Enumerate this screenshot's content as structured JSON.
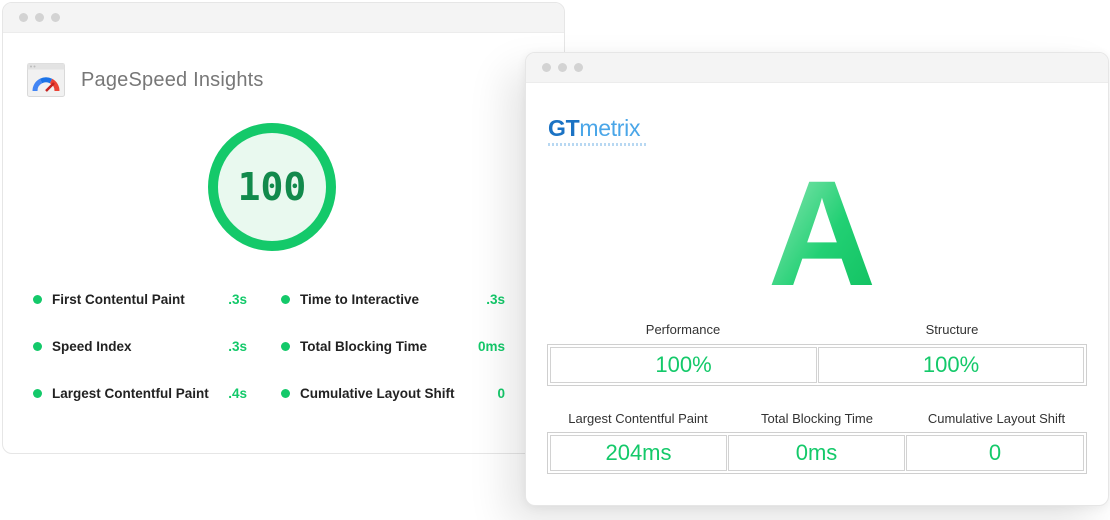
{
  "pagespeed": {
    "title": "PageSpeed Insights",
    "score": "100",
    "accent_color": "#14c96a",
    "metrics_left": [
      {
        "label": "First Contentul Paint",
        "value": ".3s"
      },
      {
        "label": "Speed Index",
        "value": ".3s"
      },
      {
        "label": "Largest Contentful Paint",
        "value": ".4s"
      }
    ],
    "metrics_right": [
      {
        "label": "Time to Interactive",
        "value": ".3s"
      },
      {
        "label": "Total Blocking Time",
        "value": "0ms"
      },
      {
        "label": "Cumulative Layout Shift",
        "value": "0"
      }
    ]
  },
  "gtmetrix": {
    "logo_gt": "GT",
    "logo_metrix": "metrix",
    "grade": "A",
    "row1": [
      {
        "label": "Performance",
        "value": "100%"
      },
      {
        "label": "Structure",
        "value": "100%"
      }
    ],
    "row2": [
      {
        "label": "Largest Contentful Paint",
        "value": "204ms"
      },
      {
        "label": "Total Blocking Time",
        "value": "0ms"
      },
      {
        "label": "Cumulative Layout Shift",
        "value": "0"
      }
    ]
  }
}
